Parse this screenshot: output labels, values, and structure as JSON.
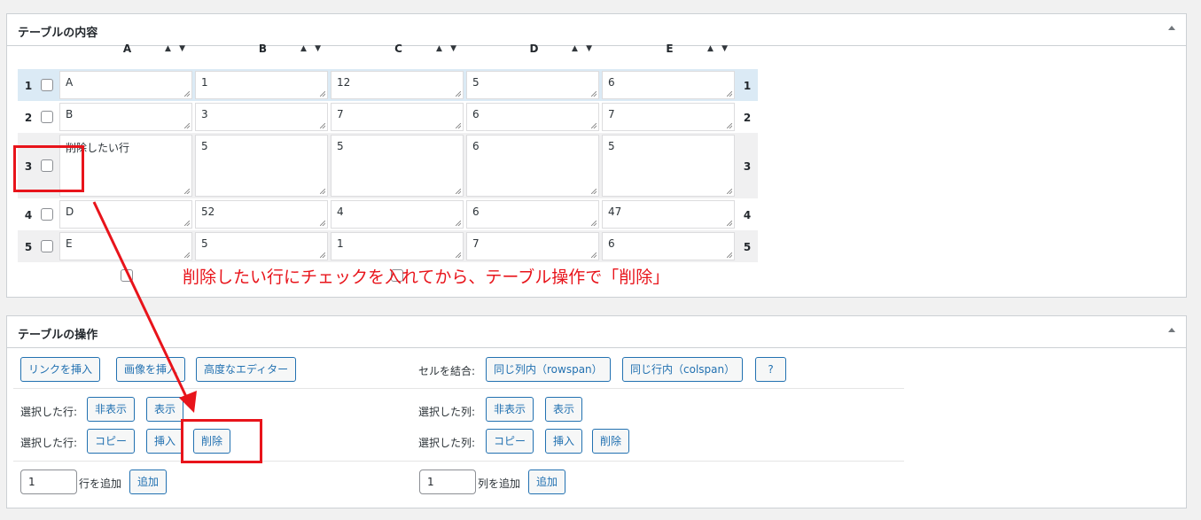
{
  "box1": {
    "title": "テーブルの内容"
  },
  "columns": [
    "A",
    "B",
    "C",
    "D",
    "E"
  ],
  "sort_glyph": "▲ ▼",
  "rows": [
    {
      "num": "1",
      "cells": [
        "A",
        "1",
        "12",
        "5",
        "6"
      ]
    },
    {
      "num": "2",
      "cells": [
        "B",
        "3",
        "7",
        "6",
        "7"
      ]
    },
    {
      "num": "3",
      "cells": [
        "削除したい行",
        "5",
        "5",
        "6",
        "5"
      ]
    },
    {
      "num": "4",
      "cells": [
        "D",
        "52",
        "4",
        "6",
        "47"
      ]
    },
    {
      "num": "5",
      "cells": [
        "E",
        "5",
        "1",
        "7",
        "6"
      ]
    }
  ],
  "annotation": "削除したい行にチェックを入れてから、テーブル操作で「削除」",
  "box2": {
    "title": "テーブルの操作",
    "insert_link": "リンクを挿入",
    "insert_image": "画像を挿入",
    "advanced_editor": "高度なエディター",
    "merge_label": "セルを結合:",
    "merge_rowspan": "同じ列内（rowspan）",
    "merge_colspan": "同じ行内（colspan）",
    "help": "?",
    "selected_rows": "選択した行:",
    "selected_cols": "選択した列:",
    "hide": "非表示",
    "show": "表示",
    "copy": "コピー",
    "insert": "挿入",
    "delete": "削除",
    "rows_add_value": "1",
    "rows_add_label": "行を追加",
    "cols_add_value": "1",
    "cols_add_label": "列を追加",
    "add": "追加"
  },
  "colors": {
    "accent": "#2271b1",
    "annotation": "#e8141b",
    "row_highlight": "#dbeaf5"
  }
}
